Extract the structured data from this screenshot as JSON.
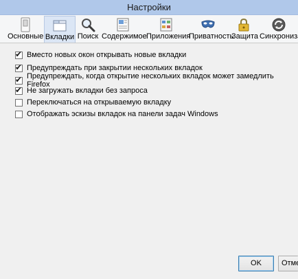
{
  "window": {
    "title": "Настройки"
  },
  "toolbar": {
    "panes": [
      {
        "label": "Основные",
        "icon": "general-switch-icon"
      },
      {
        "label": "Вкладки",
        "icon": "tabs-icon",
        "selected": true
      },
      {
        "label": "Поиск",
        "icon": "magnifier-icon"
      },
      {
        "label": "Содержимое",
        "icon": "content-icon"
      },
      {
        "label": "Приложения",
        "icon": "applications-icon"
      },
      {
        "label": "Приватность",
        "icon": "privacy-mask-icon"
      },
      {
        "label": "Защита",
        "icon": "padlock-icon"
      },
      {
        "label": "Синхронизац",
        "icon": "sync-icon"
      }
    ]
  },
  "options": [
    {
      "label": "Вместо новых окон открывать новые вкладки",
      "checked": true
    },
    {
      "label": "Предупреждать при закрытии нескольких вкладок",
      "checked": true
    },
    {
      "label": "Предупреждать, когда открытие нескольких вкладок может замедлить Firefox",
      "checked": true
    },
    {
      "label": "Не загружать вкладки без запроса",
      "checked": true
    },
    {
      "label": "Переключаться на открываемую вкладку",
      "checked": false
    },
    {
      "label": "Отображать эскизы вкладок на панели задач Windows",
      "checked": false
    }
  ],
  "buttons": {
    "ok": "OK",
    "cancel": "Отме"
  },
  "checkmark": "✔"
}
